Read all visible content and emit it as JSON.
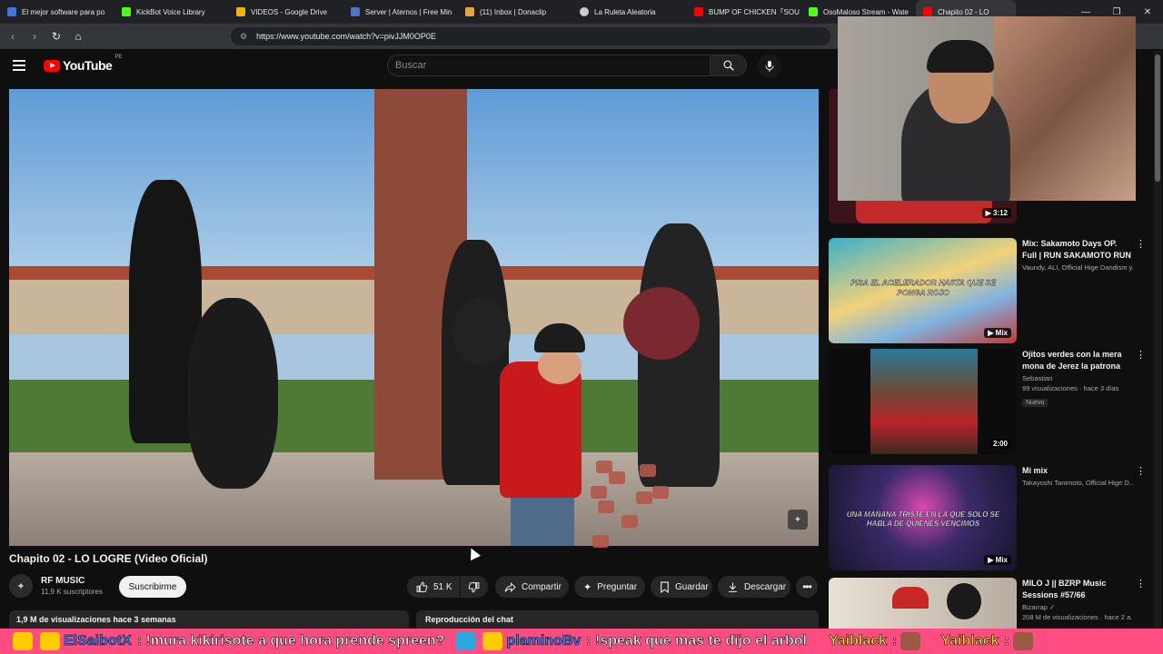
{
  "browser": {
    "tabs": [
      {
        "label": "El mejor software para po",
        "icon": "blue-app-icon",
        "color": "#3c78d8"
      },
      {
        "label": "KickBot Voice Library",
        "icon": "kick-icon",
        "color": "#53fc18"
      },
      {
        "label": "VIDEOS - Google Drive",
        "icon": "drive-icon",
        "color": "#f4b400"
      },
      {
        "label": "Server | Aternos | Free Min",
        "icon": "aternos-icon",
        "color": "#4a78c8"
      },
      {
        "label": "(11) Inbox | Donaclip",
        "icon": "mail-icon",
        "color": "#e8a33a"
      },
      {
        "label": "La Ruleta Aleatoria",
        "icon": "wheel-icon",
        "color": "#cccccc"
      },
      {
        "label": "BUMP OF CHICKEN「SOU",
        "icon": "youtube-icon",
        "color": "#ff0000"
      },
      {
        "label": "OsoMaloso Stream - Wate",
        "icon": "kick-icon",
        "color": "#53fc18"
      },
      {
        "label": "Chapito 02 - LO",
        "icon": "youtube-icon",
        "color": "#ff0000"
      }
    ],
    "url": "https://www.youtube.com/watch?v=pivJJM0OP0E"
  },
  "header": {
    "logo_text": "YouTube",
    "country_code": "PE",
    "search_placeholder": "Buscar"
  },
  "video": {
    "title": "Chapito 02 - LO LOGRE (Video Oficial)",
    "channel": "RF MUSIC",
    "subscribers": "11,9 K suscriptores",
    "subscribe_label": "Suscribirme",
    "likes": "51 K",
    "share_label": "Compartir",
    "ask_label": "Preguntar",
    "save_label": "Guardar",
    "download_label": "Descargar",
    "views_age": "1,9 M de visualizaciones  hace 3 semanas",
    "chat_replay": "Reproducción del chat"
  },
  "recommendations": [
    {
      "title": "",
      "channel": "",
      "meta": "",
      "duration": "3:12",
      "badge": ""
    },
    {
      "title": "Mix: Sakamoto Days OP. Full | RUN SAKAMOTO RUN - ...",
      "channel": "Vaundy, ALI, Official Hige Dandism y...",
      "meta": "",
      "duration": "",
      "badge": "Mix",
      "thumb_caption": "PISA EL ACELERADOR HASTA QUE SE PONGA ROJO"
    },
    {
      "title": "Ojitos verdes con la mera mona de Jerez la patrona",
      "channel": "Sebastian",
      "meta": "99 visualizaciones · hace 3 días",
      "new_label": "Nuevo",
      "duration": "2:00",
      "badge": ""
    },
    {
      "title": "Mi mix",
      "channel": "Takayoshi Tanimoto, Official Hige D...",
      "meta": "",
      "duration": "",
      "badge": "Mix",
      "thumb_caption": "UNA MAÑANA TRISTE EN LA QUE SOLO SE HABLA DE QUIENES VENCIMOS"
    },
    {
      "title": "MILO J || BZRP Music Sessions #57/66",
      "channel": "Bizarrap",
      "meta": "208 M de visualizaciones · hace 2 a...",
      "duration": "",
      "badge": ""
    }
  ],
  "ticker": {
    "user1": "ElSaibotX",
    "msg1": ": !mura kikirisote a que hora prende spreen?",
    "user2": "plaminoBv",
    "msg2": ": !speak que mas te dijo el arbol",
    "user3": "Yaiblack",
    "msg3": ":",
    "user4": "Yaiblack",
    "msg4": ":"
  },
  "colors": {
    "background": "#0f0f0f",
    "ticker": "#ff4d82",
    "accent": "#ff0000"
  }
}
